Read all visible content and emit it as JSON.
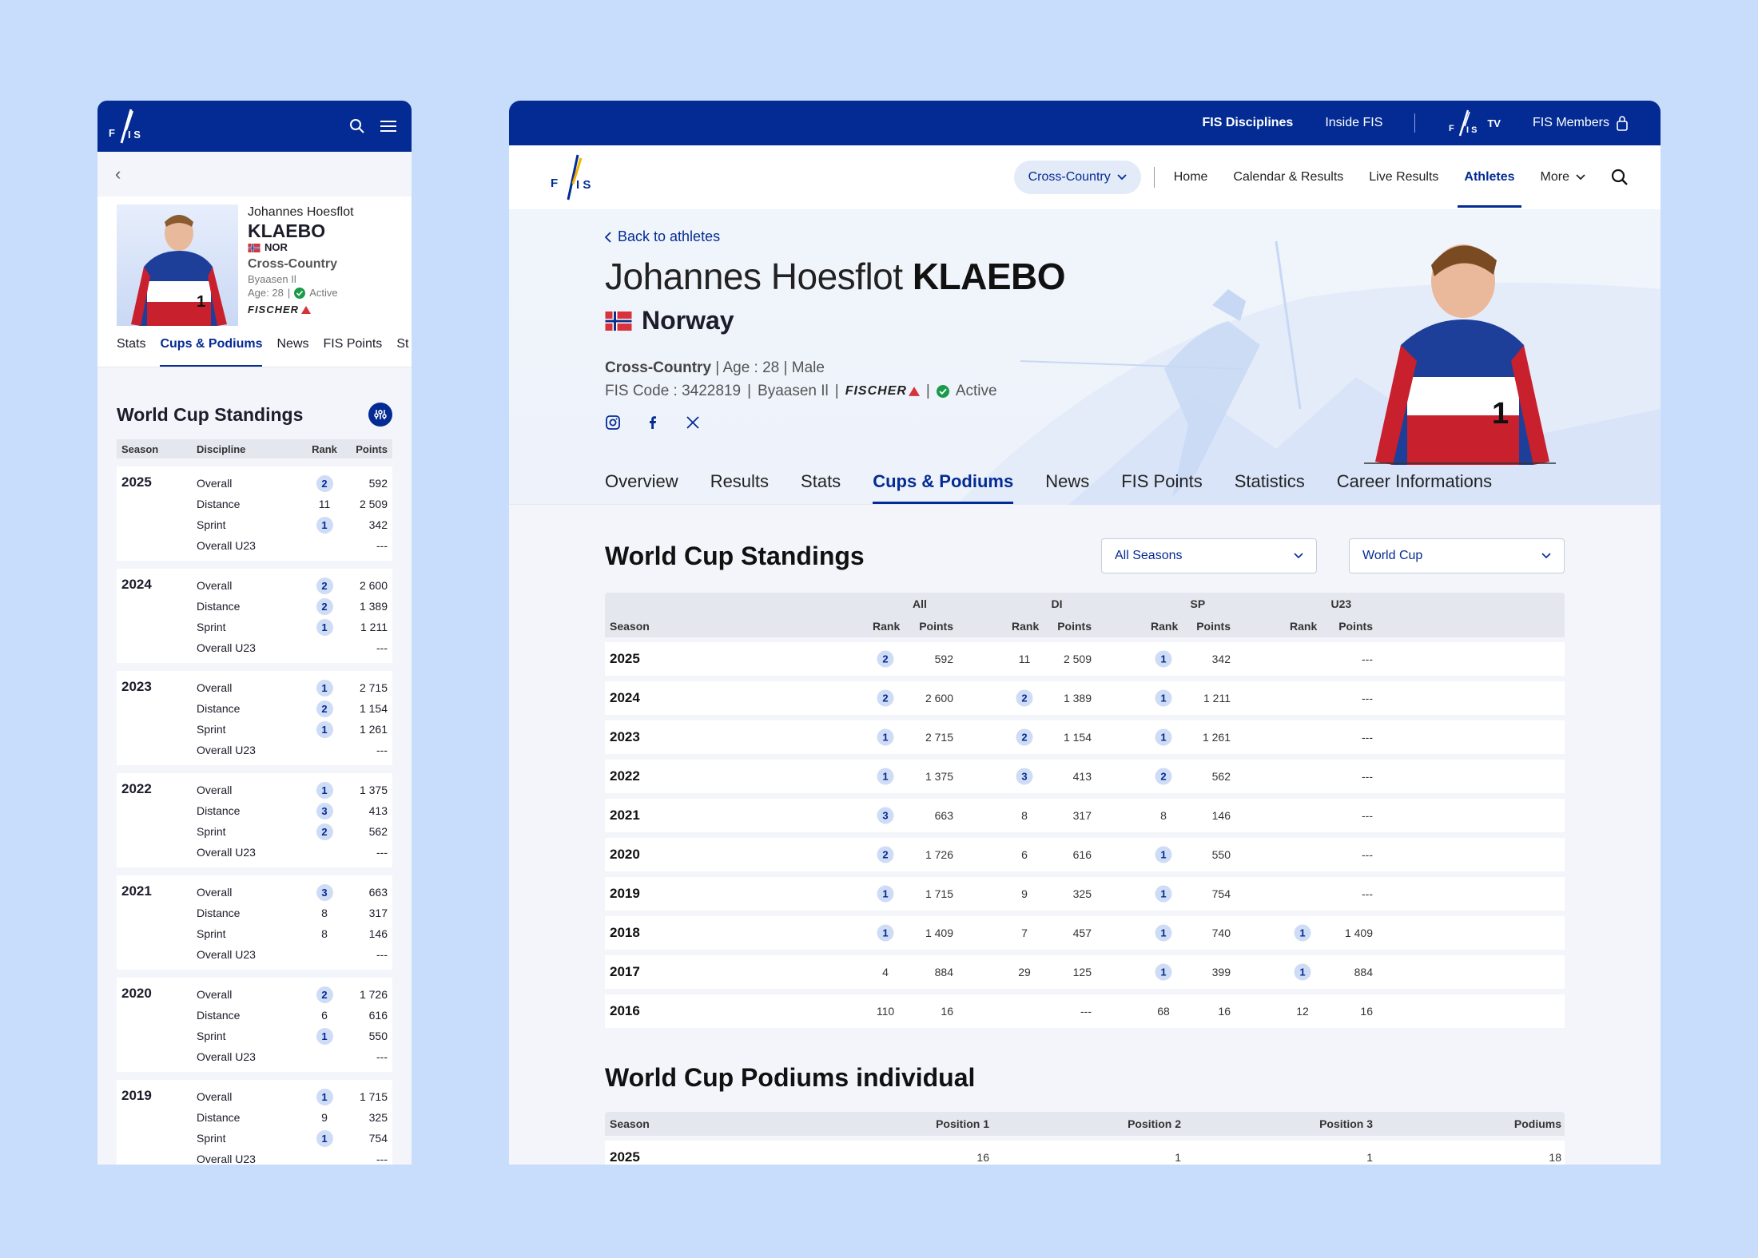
{
  "mobile": {
    "back": "‹",
    "first_name": "Johannes Hoesflot",
    "last_name": "KLAEBO",
    "nation": "NOR",
    "discipline": "Cross-Country",
    "club": "Byaasen Il",
    "age": "Age: 28",
    "status": "Active",
    "brand": "FISCHER",
    "tabs": [
      "Stats",
      "Cups & Podiums",
      "News",
      "FIS Points",
      "St"
    ],
    "section_title": "World Cup Standings",
    "headers": {
      "season": "Season",
      "discipline": "Discipline",
      "rank": "Rank",
      "points": "Points"
    },
    "seasons": [
      {
        "year": "2025",
        "rows": [
          {
            "d": "Overall",
            "r": "2",
            "b": true,
            "p": "592"
          },
          {
            "d": "Distance",
            "r": "11",
            "b": false,
            "p": "2 509"
          },
          {
            "d": "Sprint",
            "r": "1",
            "b": true,
            "p": "342"
          },
          {
            "d": "Overall U23",
            "r": "",
            "b": false,
            "p": "---"
          }
        ]
      },
      {
        "year": "2024",
        "rows": [
          {
            "d": "Overall",
            "r": "2",
            "b": true,
            "p": "2 600"
          },
          {
            "d": "Distance",
            "r": "2",
            "b": true,
            "p": "1 389"
          },
          {
            "d": "Sprint",
            "r": "1",
            "b": true,
            "p": "1 211"
          },
          {
            "d": "Overall U23",
            "r": "",
            "b": false,
            "p": "---"
          }
        ]
      },
      {
        "year": "2023",
        "rows": [
          {
            "d": "Overall",
            "r": "1",
            "b": true,
            "p": "2 715"
          },
          {
            "d": "Distance",
            "r": "2",
            "b": true,
            "p": "1 154"
          },
          {
            "d": "Sprint",
            "r": "1",
            "b": true,
            "p": "1 261"
          },
          {
            "d": "Overall U23",
            "r": "",
            "b": false,
            "p": "---"
          }
        ]
      },
      {
        "year": "2022",
        "rows": [
          {
            "d": "Overall",
            "r": "1",
            "b": true,
            "p": "1 375"
          },
          {
            "d": "Distance",
            "r": "3",
            "b": true,
            "p": "413"
          },
          {
            "d": "Sprint",
            "r": "2",
            "b": true,
            "p": "562"
          },
          {
            "d": "Overall U23",
            "r": "",
            "b": false,
            "p": "---"
          }
        ]
      },
      {
        "year": "2021",
        "rows": [
          {
            "d": "Overall",
            "r": "3",
            "b": true,
            "p": "663"
          },
          {
            "d": "Distance",
            "r": "8",
            "b": false,
            "p": "317"
          },
          {
            "d": "Sprint",
            "r": "8",
            "b": false,
            "p": "146"
          },
          {
            "d": "Overall U23",
            "r": "",
            "b": false,
            "p": "---"
          }
        ]
      },
      {
        "year": "2020",
        "rows": [
          {
            "d": "Overall",
            "r": "2",
            "b": true,
            "p": "1 726"
          },
          {
            "d": "Distance",
            "r": "6",
            "b": false,
            "p": "616"
          },
          {
            "d": "Sprint",
            "r": "1",
            "b": true,
            "p": "550"
          },
          {
            "d": "Overall U23",
            "r": "",
            "b": false,
            "p": "---"
          }
        ]
      },
      {
        "year": "2019",
        "rows": [
          {
            "d": "Overall",
            "r": "1",
            "b": true,
            "p": "1 715"
          },
          {
            "d": "Distance",
            "r": "9",
            "b": false,
            "p": "325"
          },
          {
            "d": "Sprint",
            "r": "1",
            "b": true,
            "p": "754"
          },
          {
            "d": "Overall U23",
            "r": "",
            "b": false,
            "p": "---"
          }
        ]
      }
    ]
  },
  "desktop": {
    "topbar": {
      "disciplines": "FIS Disciplines",
      "inside": "Inside FIS",
      "tv": "TV",
      "members": "FIS Members"
    },
    "nav": {
      "discipline": "Cross-Country",
      "home": "Home",
      "calendar": "Calendar & Results",
      "live": "Live Results",
      "athletes": "Athletes",
      "more": "More"
    },
    "back": "Back to athletes",
    "first_name": "Johannes Hoesflot",
    "last_name": "KLAEBO",
    "country": "Norway",
    "discipline": "Cross-Country",
    "age": "Age : 28",
    "gender": "Male",
    "fis_code": "FIS Code : 3422819",
    "club": "Byaasen Il",
    "brand": "FISCHER",
    "status": "Active",
    "bib": "1",
    "tabs": [
      "Overview",
      "Results",
      "Stats",
      "Cups & Podiums",
      "News",
      "FIS Points",
      "Statistics",
      "Career Informations"
    ],
    "standings_title": "World Cup Standings",
    "season_select": "All Seasons",
    "cup_select": "World Cup",
    "groups": [
      "All",
      "DI",
      "SP",
      "U23"
    ],
    "col_rank": "Rank",
    "col_points": "Points",
    "col_season": "Season",
    "rows": [
      {
        "year": "2025",
        "c": [
          [
            "2",
            true
          ],
          [
            "592"
          ],
          [
            "11",
            false
          ],
          [
            "2 509"
          ],
          [
            "1",
            true
          ],
          [
            "342"
          ],
          [
            "",
            false
          ],
          [
            "---"
          ]
        ]
      },
      {
        "year": "2024",
        "c": [
          [
            "2",
            true
          ],
          [
            "2 600"
          ],
          [
            "2",
            true
          ],
          [
            "1 389"
          ],
          [
            "1",
            true
          ],
          [
            "1 211"
          ],
          [
            "",
            false
          ],
          [
            "---"
          ]
        ]
      },
      {
        "year": "2023",
        "c": [
          [
            "1",
            true
          ],
          [
            "2 715"
          ],
          [
            "2",
            true
          ],
          [
            "1 154"
          ],
          [
            "1",
            true
          ],
          [
            "1 261"
          ],
          [
            "",
            false
          ],
          [
            "---"
          ]
        ]
      },
      {
        "year": "2022",
        "c": [
          [
            "1",
            true
          ],
          [
            "1 375"
          ],
          [
            "3",
            true
          ],
          [
            "413"
          ],
          [
            "2",
            true
          ],
          [
            "562"
          ],
          [
            "",
            false
          ],
          [
            "---"
          ]
        ]
      },
      {
        "year": "2021",
        "c": [
          [
            "3",
            true
          ],
          [
            "663"
          ],
          [
            "8",
            false
          ],
          [
            "317"
          ],
          [
            "8",
            false
          ],
          [
            "146"
          ],
          [
            "",
            false
          ],
          [
            "---"
          ]
        ]
      },
      {
        "year": "2020",
        "c": [
          [
            "2",
            true
          ],
          [
            "1 726"
          ],
          [
            "6",
            false
          ],
          [
            "616"
          ],
          [
            "1",
            true
          ],
          [
            "550"
          ],
          [
            "",
            false
          ],
          [
            "---"
          ]
        ]
      },
      {
        "year": "2019",
        "c": [
          [
            "1",
            true
          ],
          [
            "1 715"
          ],
          [
            "9",
            false
          ],
          [
            "325"
          ],
          [
            "1",
            true
          ],
          [
            "754"
          ],
          [
            "",
            false
          ],
          [
            "---"
          ]
        ]
      },
      {
        "year": "2018",
        "c": [
          [
            "1",
            true
          ],
          [
            "1 409"
          ],
          [
            "7",
            false
          ],
          [
            "457"
          ],
          [
            "1",
            true
          ],
          [
            "740"
          ],
          [
            "1",
            true
          ],
          [
            "1 409"
          ]
        ]
      },
      {
        "year": "2017",
        "c": [
          [
            "4",
            false
          ],
          [
            "884"
          ],
          [
            "29",
            false
          ],
          [
            "125"
          ],
          [
            "1",
            true
          ],
          [
            "399"
          ],
          [
            "1",
            true
          ],
          [
            "884"
          ]
        ]
      },
      {
        "year": "2016",
        "c": [
          [
            "110",
            false
          ],
          [
            "16"
          ],
          [
            "",
            false
          ],
          [
            "---"
          ],
          [
            "68",
            false
          ],
          [
            "16"
          ],
          [
            "12",
            false
          ],
          [
            "16"
          ]
        ]
      }
    ],
    "podiums_title": "World Cup Podiums individual",
    "podium_headers": [
      "Season",
      "Position 1",
      "Position 2",
      "Position 3",
      "Podiums"
    ],
    "podium_rows": [
      [
        "2025",
        "16",
        "1",
        "1",
        "18"
      ]
    ]
  },
  "colors": {
    "brand_blue": "#032b93",
    "badge_bg": "#cfdcf6",
    "status_green": "#1a9a4a",
    "flag_red": "#d8323c"
  }
}
